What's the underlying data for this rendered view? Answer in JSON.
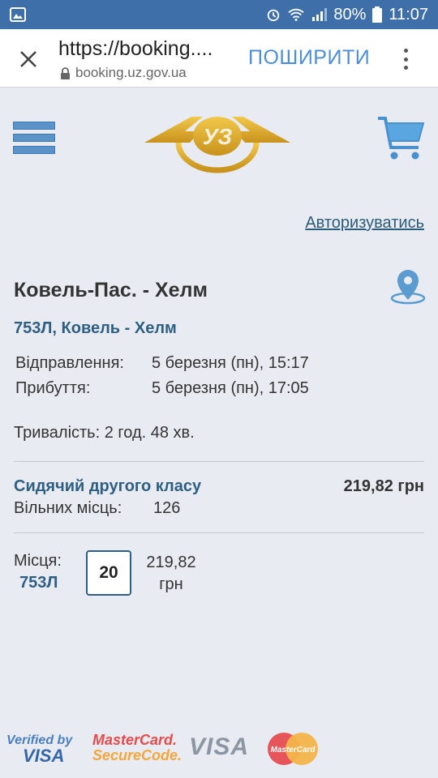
{
  "status_bar": {
    "battery": "80%",
    "time": "11:07"
  },
  "browser": {
    "url_title": "https://booking....",
    "domain": "booking.uz.gov.ua",
    "share_label": "ПОШИРИТИ"
  },
  "header": {
    "login_link": "Авторизуватись",
    "logo_text": "УЗ"
  },
  "route": {
    "title": "Ковель-Пас. - Хелм",
    "train": "753Л, Ковель - Хелм"
  },
  "schedule": [
    {
      "label": "Відправлення:",
      "value": "5 березня (пн), 15:17"
    },
    {
      "label": "Прибуття:",
      "value": "5 березня (пн), 17:05"
    }
  ],
  "duration": "Тривалість: 2 год. 48 хв.",
  "wagon_class": {
    "name": "Сидячий другого класу",
    "price": "219,82 грн",
    "free_label": "Вільних місць:",
    "free_value": "126"
  },
  "places": {
    "label": "Місця:",
    "train": "753Л",
    "seat": "20",
    "price_line1": "219,82",
    "price_line2": "грн"
  },
  "payment_logos": {
    "vbv_line1": "Verified by",
    "vbv_line2": "VISA",
    "mcsc_line1": "MasterCard.",
    "mcsc_line2": "SecureCode.",
    "visa": "VISA",
    "mastercard": "MasterCard"
  },
  "colors": {
    "status_bar": "#3f6fa8",
    "accent_blue": "#2e5f82",
    "share_blue": "#4d8ed8",
    "logo_gold": "#d9a72a",
    "background": "#e8ecf2"
  }
}
